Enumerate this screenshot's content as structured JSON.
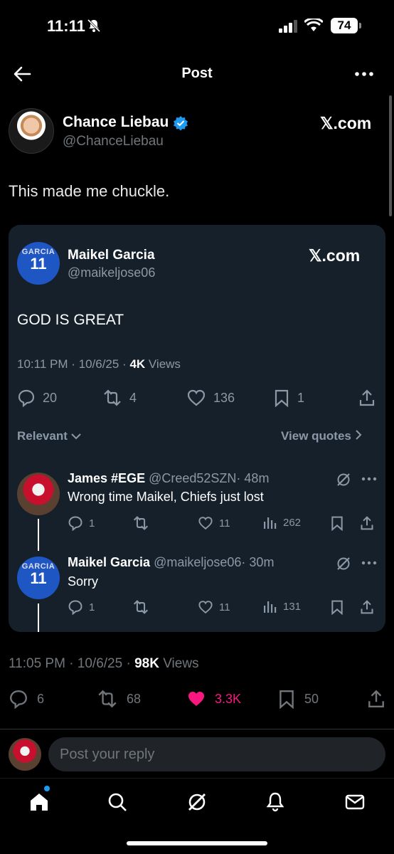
{
  "status_bar": {
    "time": "11:11",
    "battery": "74"
  },
  "header": {
    "title": "Post"
  },
  "post": {
    "author_name": "Chance Liebau",
    "author_handle": "@ChanceLiebau",
    "source": "𝕏.com",
    "text": "This made me chuckle.",
    "time": "11:05 PM · 10/6/25 · ",
    "views_count": "98K",
    "views_label": " Views",
    "stats": {
      "replies": "6",
      "reposts": "68",
      "likes": "3.3K",
      "bookmarks": "50"
    },
    "colors": {
      "like": "#f91880",
      "accent": "#1d9bf0"
    }
  },
  "embedded": {
    "author_name": "Maikel Garcia",
    "author_handle": "@maikeljose06",
    "source": "𝕏.com",
    "avatar": {
      "jersey_name": "GARCIA",
      "jersey_number": "11"
    },
    "text": "GOD IS GREAT",
    "time": "10:11 PM · 10/6/25 · ",
    "views_count": "4K",
    "views_label": " Views",
    "stats": {
      "replies": "20",
      "reposts": "4",
      "likes": "136",
      "bookmarks": "1"
    },
    "sort_label": "Relevant",
    "view_quotes_label": "View quotes",
    "replies": [
      {
        "name": "James #EGE",
        "handle": "@Creed52SZN",
        "time": "· 48m",
        "text": "Wrong time Maikel, Chiefs just lost",
        "stats": {
          "replies": "1",
          "likes": "11",
          "views": "262"
        }
      },
      {
        "name": "Maikel Garcia",
        "handle": "@maikeljose06",
        "time": "· 30m",
        "text": "Sorry",
        "stats": {
          "replies": "1",
          "likes": "11",
          "views": "131"
        }
      }
    ]
  },
  "composer": {
    "placeholder": "Post your reply"
  },
  "nav": [
    "home-icon",
    "search-icon",
    "grok-icon",
    "notifications-icon",
    "messages-icon"
  ]
}
